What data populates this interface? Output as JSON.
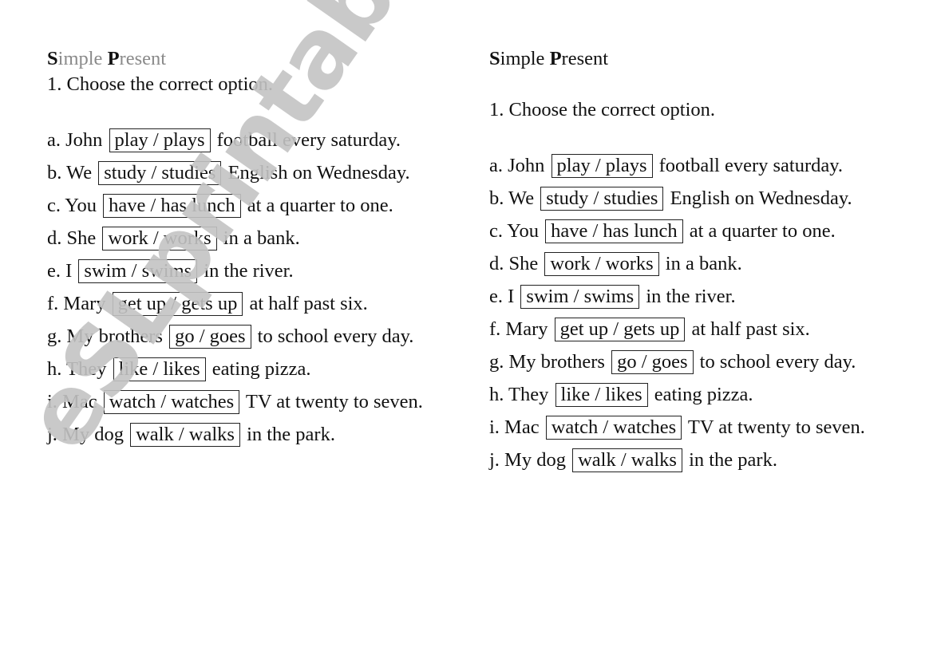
{
  "watermark": "eSLprintables.com",
  "worksheets": [
    {
      "title_initial_1": "S",
      "title_rest_1": "imple ",
      "title_initial_2": "P",
      "title_rest_2": "resent",
      "instruction": "1. Choose the correct option.",
      "items": [
        {
          "prefix": "a. John",
          "option": "play / plays",
          "suffix": "football every saturday."
        },
        {
          "prefix": "b. We",
          "option": "study / studies",
          "suffix": "English on Wednesday."
        },
        {
          "prefix": "c. You",
          "option": "have / has lunch",
          "suffix": "at a quarter to one."
        },
        {
          "prefix": "d. She",
          "option": "work / works",
          "suffix": "in a bank."
        },
        {
          "prefix": "e. I",
          "option": "swim / swims",
          "suffix": "in the river."
        },
        {
          "prefix": "f. Mary",
          "option": "get up / gets up",
          "suffix": "at half past six."
        },
        {
          "prefix": "g. My brothers",
          "option": "go / goes",
          "suffix": "to school every day."
        },
        {
          "prefix": "h. They",
          "option": "like / likes",
          "suffix": "eating pizza."
        },
        {
          "prefix": "i. Mac",
          "option": "watch / watches",
          "suffix": "TV at twenty to seven."
        },
        {
          "prefix": "j. My dog",
          "option": "walk / walks",
          "suffix": "in the park."
        }
      ]
    },
    {
      "title_initial_1": "S",
      "title_rest_1": "imple ",
      "title_initial_2": "P",
      "title_rest_2": "resent",
      "instruction": "1. Choose the correct option.",
      "items": [
        {
          "prefix": "a. John",
          "option": "play / plays",
          "suffix": "football every saturday."
        },
        {
          "prefix": "b. We",
          "option": "study / studies",
          "suffix": "English on Wednesday."
        },
        {
          "prefix": "c. You",
          "option": "have / has lunch",
          "suffix": "at a quarter to one."
        },
        {
          "prefix": "d. She",
          "option": "work / works",
          "suffix": "in a bank."
        },
        {
          "prefix": "e. I",
          "option": "swim / swims",
          "suffix": "in the river."
        },
        {
          "prefix": "f. Mary",
          "option": "get up / gets up",
          "suffix": "at half past six."
        },
        {
          "prefix": "g. My brothers",
          "option": "go / goes",
          "suffix": "to school every day."
        },
        {
          "prefix": "h. They",
          "option": "like / likes",
          "suffix": "eating pizza."
        },
        {
          "prefix": "i. Mac",
          "option": "watch / watches",
          "suffix": "TV at twenty to seven."
        },
        {
          "prefix": "j. My dog",
          "option": "walk / walks",
          "suffix": "in the park."
        }
      ]
    }
  ]
}
